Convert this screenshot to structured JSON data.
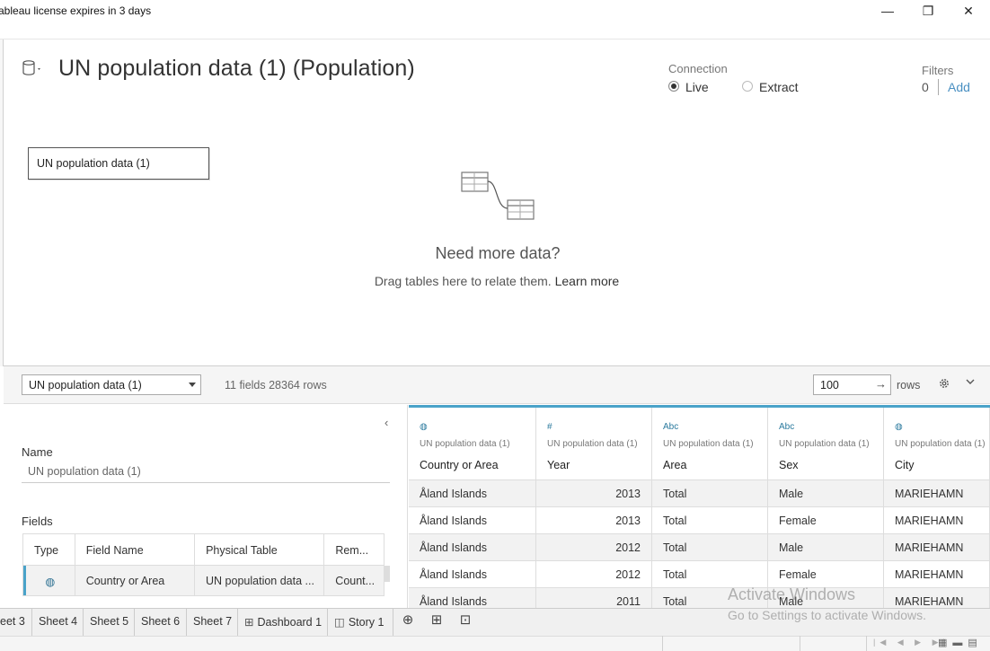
{
  "window": {
    "title": "ableau license expires in 3 days",
    "minimize": "—",
    "restore": "❐",
    "close": "✕"
  },
  "header": {
    "datasource_title": "UN population data (1) (Population)",
    "connection_label": "Connection",
    "live_label": "Live",
    "extract_label": "Extract",
    "connection_selected": "Live",
    "filters_label": "Filters",
    "filters_count": "0",
    "filters_add": "Add"
  },
  "canvas": {
    "table_name": "UN population data (1)",
    "need_more_title": "Need more data?",
    "need_more_text": "Drag tables here to relate them.",
    "learn_more": "Learn more"
  },
  "toolbar": {
    "table_select": "UN population data (1)",
    "fields_rows": "11 fields 28364 rows",
    "rows_value": "100",
    "rows_arrow": "→",
    "rows_label": "rows",
    "collapse_icon": "‹"
  },
  "metadata": {
    "name_label": "Name",
    "name_value": "UN population data (1)",
    "fields_label": "Fields",
    "columns": [
      "Type",
      "Field Name",
      "Physical Table",
      "Rem..."
    ],
    "rows": [
      {
        "type_icon": "globe-icon",
        "type_glyph": "◍",
        "field_name": "Country or Area",
        "physical_table": "UN population data ...",
        "remote": "Count..."
      }
    ]
  },
  "datagrid": {
    "columns": [
      {
        "icon": "globe-icon",
        "glyph": "◍",
        "source": "UN population data (1)",
        "name": "Country or Area"
      },
      {
        "icon": "number-icon",
        "glyph": "#",
        "source": "UN population data (1)",
        "name": "Year"
      },
      {
        "icon": "string-icon",
        "glyph": "Abc",
        "source": "UN population data (1)",
        "name": "Area"
      },
      {
        "icon": "string-icon",
        "glyph": "Abc",
        "source": "UN population data (1)",
        "name": "Sex"
      },
      {
        "icon": "globe-icon",
        "glyph": "◍",
        "source": "UN population data (1)",
        "name": "City"
      }
    ],
    "rows": [
      [
        "Åland Islands",
        "2013",
        "Total",
        "Male",
        "MARIEHAMN"
      ],
      [
        "Åland Islands",
        "2013",
        "Total",
        "Female",
        "MARIEHAMN"
      ],
      [
        "Åland Islands",
        "2012",
        "Total",
        "Male",
        "MARIEHAMN"
      ],
      [
        "Åland Islands",
        "2012",
        "Total",
        "Female",
        "MARIEHAMN"
      ],
      [
        "Åland Islands",
        "2011",
        "Total",
        "Male",
        "MARIEHAMN"
      ]
    ]
  },
  "sheet_tabs": [
    {
      "label": "eet 3",
      "icon": ""
    },
    {
      "label": "Sheet 4",
      "icon": ""
    },
    {
      "label": "Sheet 5",
      "icon": ""
    },
    {
      "label": "Sheet 6",
      "icon": ""
    },
    {
      "label": "Sheet 7",
      "icon": ""
    },
    {
      "label": "Dashboard 1",
      "icon": "⊞"
    },
    {
      "label": "Story 1",
      "icon": "◫"
    }
  ],
  "new_buttons": [
    {
      "name": "new-worksheet-button",
      "glyph": "⊕"
    },
    {
      "name": "new-dashboard-button",
      "glyph": "⊞"
    },
    {
      "name": "new-story-button",
      "glyph": "⊡"
    }
  ],
  "watermark": {
    "line1": "Activate Windows",
    "line2": "Go to Settings to activate Windows."
  },
  "colors": {
    "accent": "#4aa3c9",
    "link": "#4a90c2"
  }
}
